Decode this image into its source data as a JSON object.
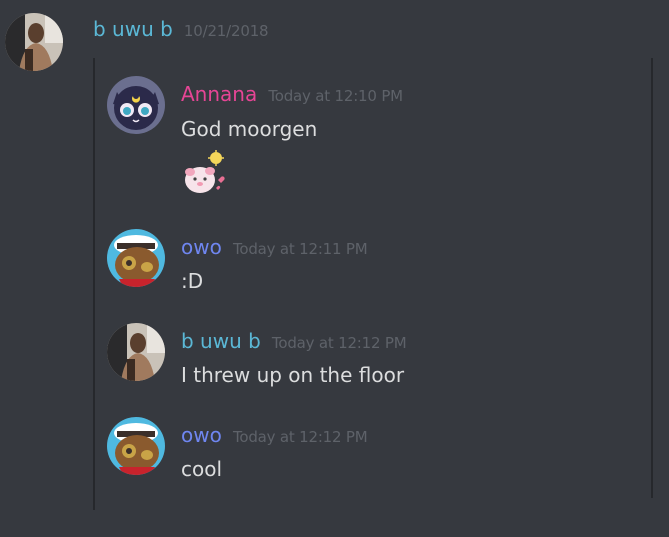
{
  "header": {
    "author": "b uwu b",
    "date": "10/21/2018",
    "author_color": "#5bb8d6"
  },
  "messages": [
    {
      "author": "Annana",
      "time": "Today at 12:10 PM",
      "text": "God moorgen",
      "author_color": "#e64595",
      "avatar_icon": "sailor-moon-luna-cat-avatar",
      "sticker_icon": "pink-cat-sticker"
    },
    {
      "author": "owo",
      "time": "Today at 12:11 PM",
      "text": ":D",
      "author_color": "#6f86f0",
      "avatar_icon": "cartoon-dog-hat-avatar"
    },
    {
      "author": "b uwu b",
      "time": "Today at 12:12 PM",
      "text": "I threw up on the floor",
      "author_color": "#5bb8d6",
      "avatar_icon": "photo-man-avatar"
    },
    {
      "author": "owo",
      "time": "Today at 12:12 PM",
      "text": "cool",
      "author_color": "#6f86f0",
      "avatar_icon": "cartoon-dog-hat-avatar"
    }
  ],
  "colors": {
    "background": "#36393f",
    "text": "#dcddde",
    "timestamp": "#5e6269"
  }
}
